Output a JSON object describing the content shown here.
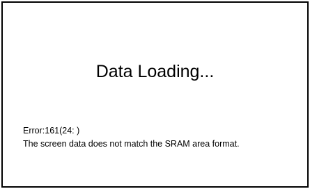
{
  "screen": {
    "title": "Data Loading...",
    "error_code": "Error:161(24: )",
    "error_message": "The screen data does not match the SRAM area format."
  },
  "colors": {
    "background": "#ffffff",
    "border": "#000000",
    "text": "#000000"
  }
}
